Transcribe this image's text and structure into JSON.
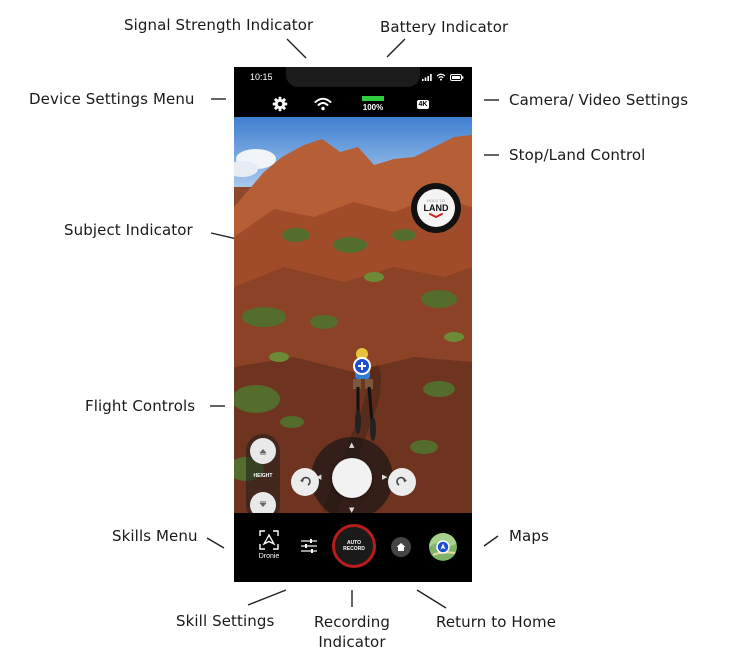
{
  "callouts": {
    "signal_strength": "Signal Strength Indicator",
    "battery": "Battery Indicator",
    "device_settings": "Device Settings Menu",
    "camera_video": "Camera/ Video Settings",
    "stop_land": "Stop/Land Control",
    "subject": "Subject Indicator",
    "flight_controls": "Flight Controls",
    "skills_menu": "Skills Menu",
    "maps": "Maps",
    "skill_settings": "Skill Settings",
    "recording": "Recording Indicator",
    "return_home": "Return to Home"
  },
  "phone": {
    "status_time": "10:15",
    "battery_percent": "100%",
    "battery_level": 1.0,
    "camera_mode": "4K",
    "land_small": "HOLD TO",
    "land_big": "LAND",
    "height_label": "HEIGHT",
    "skill_label": "Dronie",
    "record_label": "AUTO RECORD"
  },
  "icons": [
    "gear-icon",
    "wifi-icon",
    "battery-icon",
    "signal-icon",
    "plus-icon",
    "chevron-up-icon",
    "chevron-down-icon",
    "rotate-left-icon",
    "rotate-right-icon",
    "sliders-icon",
    "home-icon",
    "map-icon"
  ],
  "colors": {
    "battery_green": "#2ecc40",
    "record_ring": "#b91c1c",
    "land_chevron": "#d0202a",
    "subject_blue": "#1f4fd1"
  }
}
